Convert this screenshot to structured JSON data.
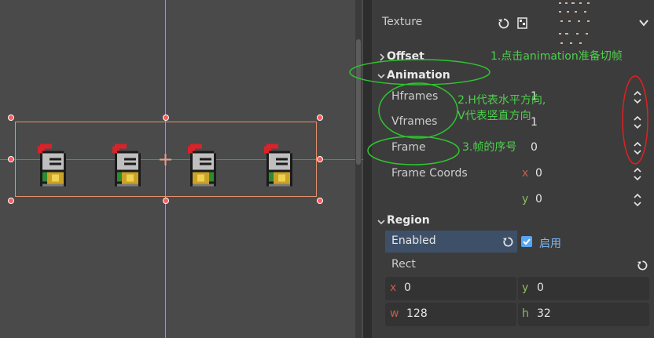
{
  "inspector": {
    "texture_label": "Texture",
    "offset_label": "Offset",
    "animation_label": "Animation",
    "hframes_label": "Hframes",
    "hframes_value": "1",
    "vframes_label": "Vframes",
    "vframes_value": "1",
    "frame_label": "Frame",
    "frame_value": "0",
    "frame_coords_label": "Frame Coords",
    "frame_coords_x_axis": "x",
    "frame_coords_x": "0",
    "frame_coords_y_axis": "y",
    "frame_coords_y": "0",
    "region_label": "Region",
    "enabled_label": "Enabled",
    "enabled_checkbox_label": "启用",
    "rect_label": "Rect",
    "rect_x_axis": "x",
    "rect_x": "0",
    "rect_y_axis": "y",
    "rect_y": "0",
    "rect_w_axis": "w",
    "rect_w": "128",
    "rect_h_axis": "h",
    "rect_h": "32"
  },
  "annotations": {
    "note1": "1.点击animation准备切帧",
    "note2_line1": "2.H代表水平方向,",
    "note2_line2": "V代表竖直方向",
    "note3": "3.帧的序号"
  },
  "colors": {
    "annotation_green": "#2fc42f",
    "annotation_red": "#e02020",
    "selection": "#e5926a",
    "handle": "#ff5a5a"
  },
  "icons": [
    "reset-icon",
    "texture-load-icon",
    "spin-arrows-icon",
    "checkbox-checked-icon",
    "chevron-right-icon",
    "chevron-down-icon"
  ]
}
